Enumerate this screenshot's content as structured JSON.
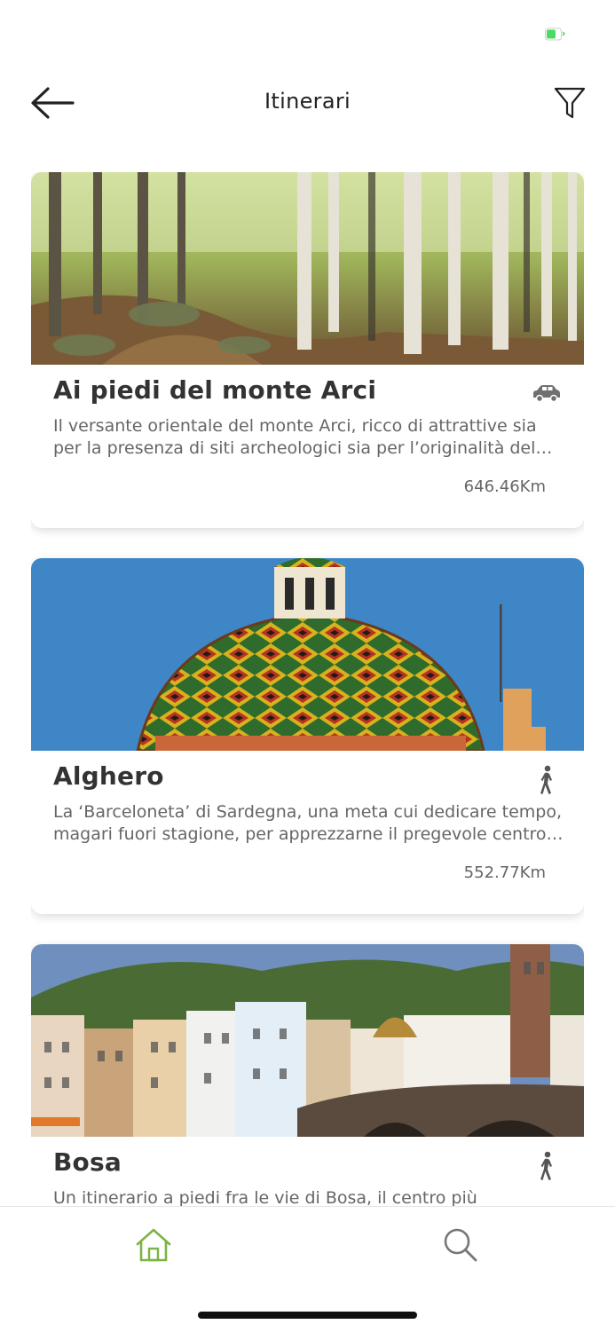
{
  "header": {
    "title": "Itinerari"
  },
  "itineraries": [
    {
      "title": "Ai piedi del monte Arci",
      "description": "Il versante orientale del monte Arci, ricco di attrattive sia per la presenza di siti archeologici sia per l’originalità del paesaggio",
      "distance": "646.46Km",
      "mode": "car-icon"
    },
    {
      "title": "Alghero",
      "description": "La ‘Barceloneta’ di Sardegna, una meta cui dedicare tempo, magari fuori stagione, per apprezzarne il pregevole centro storico",
      "distance": "552.77Km",
      "mode": "walking-icon"
    },
    {
      "title": "Bosa",
      "description": "Un itinerario a piedi fra le vie di Bosa, il centro più",
      "distance": "",
      "mode": "walking-icon"
    }
  ],
  "colors": {
    "accent": "#7cb342",
    "battery": "#4cd964",
    "text": "#333333",
    "muted": "#666666"
  }
}
